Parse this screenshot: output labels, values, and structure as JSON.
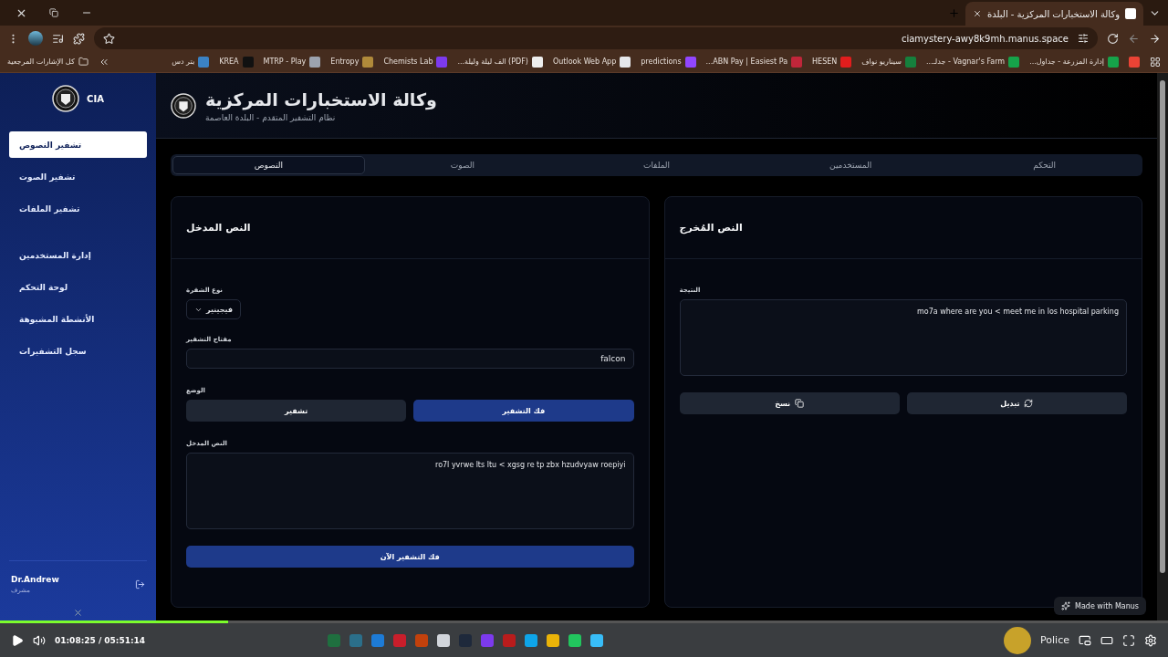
{
  "browser": {
    "tab": {
      "title": "وكالة الاستخبارات المركزية - البلدة",
      "selected": true
    },
    "url": "ciamystery-awy8k9mh.manus.space",
    "bookmarks_folder": "كل الإشارات المرجعية",
    "bookmarks": [
      {
        "color": "#ea4335"
      },
      {
        "label": "إدارة المزرعة - جداول...",
        "color": "#16a34a"
      },
      {
        "label": "Vagnar's Farm - جدلـ...",
        "color": "#16a34a"
      },
      {
        "label": "سيناريو نواف",
        "color": "#15803d"
      },
      {
        "label": "HESEN",
        "color": "#e11d1d"
      },
      {
        "label": "ABN Pay | Easiest Pa...",
        "color": "#c0263a"
      },
      {
        "label": "predictions",
        "color": "#9146ff"
      },
      {
        "label": "Outlook Web App",
        "color": "#e5e7eb"
      },
      {
        "label": "(PDF) الف ليلة وليلة...",
        "color": "#eeeeee"
      },
      {
        "label": "Chemists Lab",
        "color": "#7c3aed"
      },
      {
        "label": "Entropy",
        "color": "#b08a3a"
      },
      {
        "label": "MTRP - Play",
        "color": "#9ca3af"
      },
      {
        "label": "KREA",
        "color": "#111111"
      },
      {
        "label": "بتر دس",
        "color": "#3b82c4"
      }
    ]
  },
  "sidebar": {
    "brand": "CIA",
    "sections": [
      {
        "items": [
          {
            "label": "تشفير النصوص",
            "selected": true
          },
          {
            "label": "تشفير الصوت",
            "selected": false
          },
          {
            "label": "تشفير الملفات",
            "selected": false
          }
        ]
      },
      {
        "items": [
          {
            "label": "إدارة المستخدمين",
            "selected": false
          },
          {
            "label": "لوحة التحكم",
            "selected": false
          },
          {
            "label": "الأنشطة المشبوهة",
            "selected": false
          },
          {
            "label": "سجل التشفيرات",
            "selected": false
          }
        ]
      }
    ],
    "user": {
      "name": "Dr.Andrew",
      "role": "مشرف"
    }
  },
  "header": {
    "title": "وكالة الاستخبارات المركزية",
    "subtitle": "نظام التشفير المتقدم - البلدة العاصمة"
  },
  "tabs": [
    {
      "label": "التحكم",
      "selected": false
    },
    {
      "label": "المستخدمين",
      "selected": false
    },
    {
      "label": "الملفات",
      "selected": false
    },
    {
      "label": "الصوت",
      "selected": false
    },
    {
      "label": "النصوص",
      "selected": true
    }
  ],
  "input_card": {
    "title": "النص المدخل",
    "cipher_type": {
      "label": "نوع الشفرة",
      "value": "فيجينير"
    },
    "key": {
      "label": "مفتاح التشفير",
      "value": "falcon"
    },
    "mode": {
      "label": "الوضع",
      "options": [
        {
          "label": "فك التشفير",
          "selected": true
        },
        {
          "label": "تشفير",
          "selected": false
        }
      ]
    },
    "text": {
      "label": "النص المدخل",
      "value": "ro7l yvrwe lts ltu < xgsg re tp zbx hzudvyaw roepiyi"
    },
    "submit": "فك التشفير الآن"
  },
  "output_card": {
    "title": "النص المُخرج",
    "result": {
      "label": "النتيجة",
      "value": "mo7a where are you < meet me in los hospital parking"
    },
    "buttons": [
      {
        "label": "تبديل",
        "kind": "swap"
      },
      {
        "label": "نسخ",
        "kind": "copy"
      }
    ]
  },
  "badge": "Made with Manus",
  "player": {
    "level": 0.195,
    "time": "01:08:25 / 05:51:14",
    "taskbar_label": "Police",
    "taskbar_apps": [
      {
        "color": "#1f6f3f"
      },
      {
        "color": "#2b6f8a"
      },
      {
        "color": "#1d7bd6"
      },
      {
        "color": "#c81e2b"
      },
      {
        "color": "#c2410c"
      },
      {
        "color": "#d1d5db"
      },
      {
        "color": "#1e293b"
      },
      {
        "color": "#7c3aed"
      },
      {
        "color": "#b91c1c"
      },
      {
        "color": "#0ea5e9"
      },
      {
        "color": "#eab308"
      },
      {
        "color": "#22c55e"
      },
      {
        "color": "#38bdf8"
      }
    ]
  }
}
